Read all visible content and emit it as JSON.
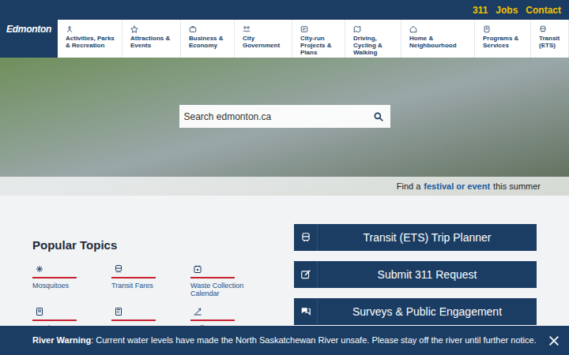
{
  "logo": "Edmonton",
  "utility_links": [
    "311",
    "Jobs",
    "Contact"
  ],
  "nav": [
    "Activities, Parks & Recreation",
    "Attractions & Events",
    "Business & Economy",
    "City Government",
    "City-run Projects & Plans",
    "Driving, Cycling & Walking",
    "Home & Neighbourhood",
    "Programs & Services",
    "Transit (ETS)"
  ],
  "search": {
    "placeholder": "Search edmonton.ca"
  },
  "hero_caption": {
    "before": "Find a",
    "link": "festival or event",
    "after": "this summer"
  },
  "popular_topics": {
    "title": "Popular Topics",
    "items": [
      "Mosquitoes",
      "Transit Fares",
      "Waste Collection Calendar",
      "EPark",
      "Property Taxes",
      "Golf"
    ]
  },
  "actions": [
    "Transit (ETS) Trip Planner",
    "Submit 311 Request",
    "Surveys & Public Engagement"
  ],
  "alert": {
    "title": "River Warning",
    "message": ": Current water levels have made the North Saskatchewan River unsafe. Please stay off the river until further notice."
  }
}
